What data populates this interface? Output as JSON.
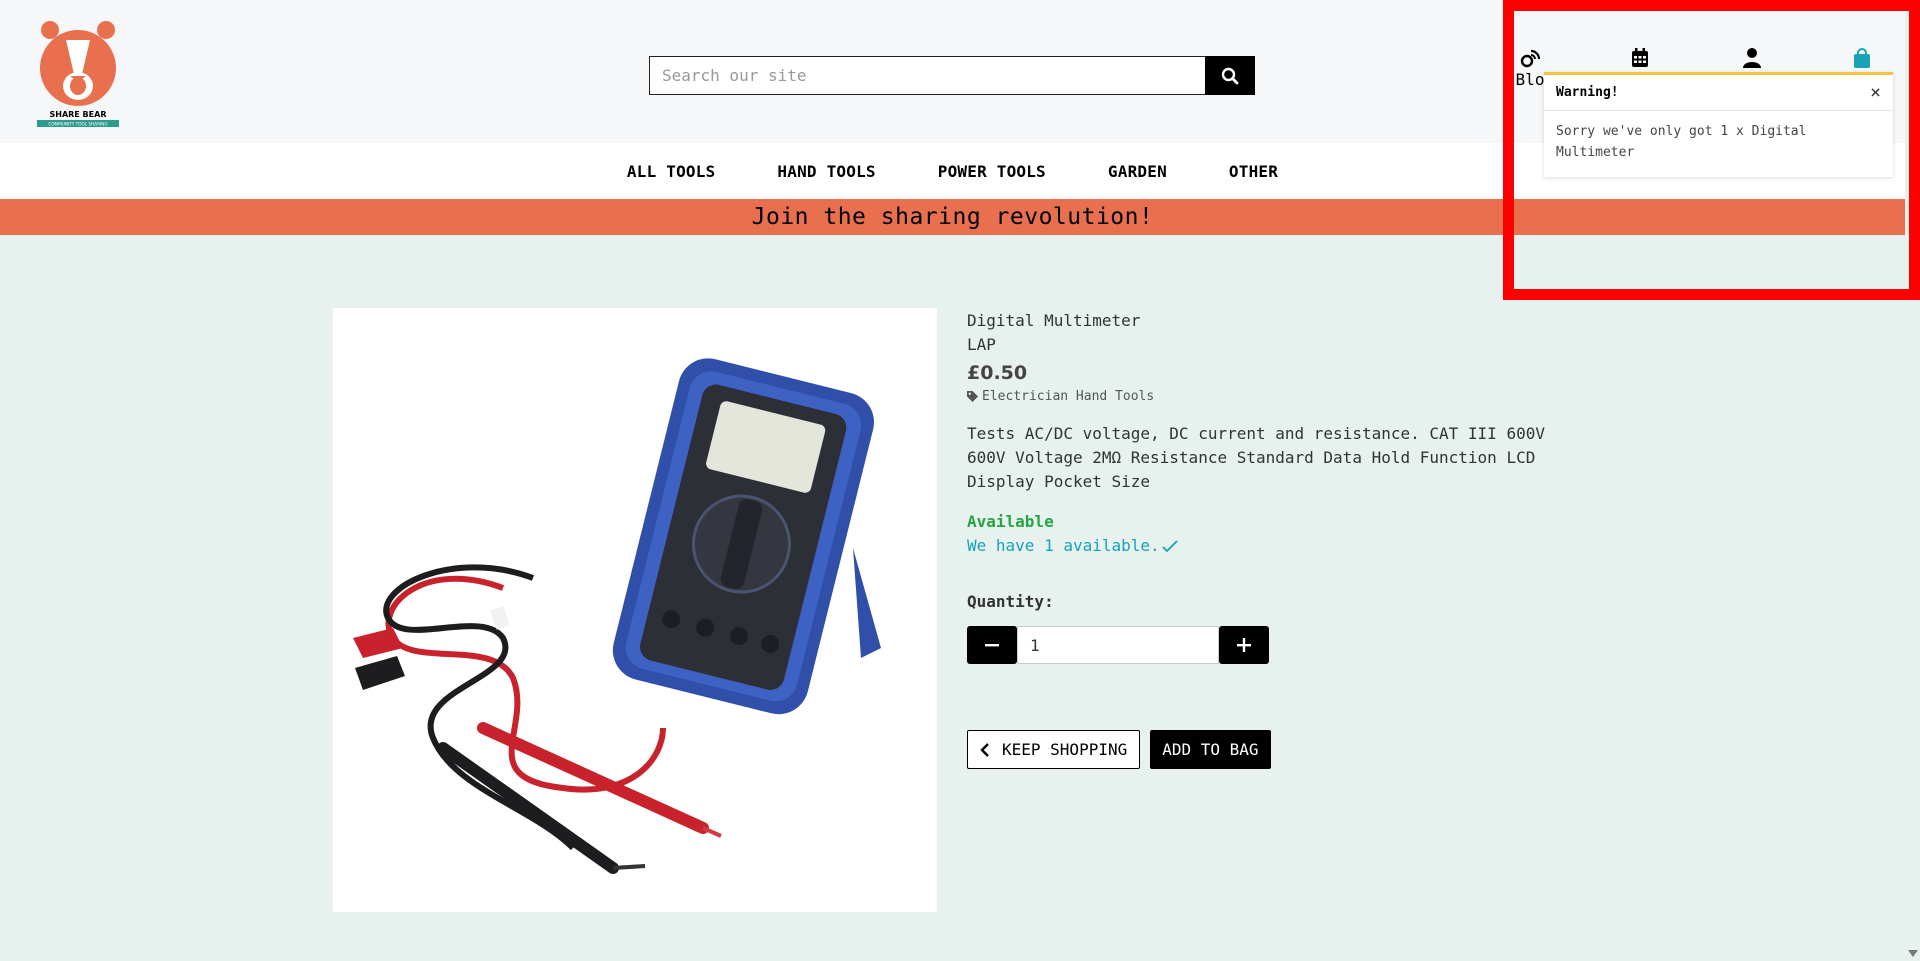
{
  "header": {
    "logo": {
      "text": "SHARE BEAR",
      "tagline": "COMMUNITY TOOL SHARING",
      "color": "#e8704f",
      "band_color": "#2a9d8f"
    },
    "search": {
      "placeholder": "Search our site",
      "value": ""
    },
    "icons": [
      {
        "icon": "blog-rss-icon",
        "label": "Blo"
      },
      {
        "icon": "calendar-icon",
        "label": ""
      },
      {
        "icon": "user-icon",
        "label": ""
      },
      {
        "icon": "shopping-bag-icon",
        "label": ""
      }
    ]
  },
  "nav": {
    "items": [
      "ALL TOOLS",
      "HAND TOOLS",
      "POWER TOOLS",
      "GARDEN",
      "OTHER"
    ]
  },
  "banner": {
    "text": "Join the sharing revolution!",
    "color": "#e8704f"
  },
  "product": {
    "name": "Digital Multimeter",
    "brand": "LAP",
    "price": "£0.50",
    "category": "Electrician Hand Tools",
    "description": "Tests AC/DC voltage, DC current and resistance. CAT III 600V 600V Voltage 2MΩ Resistance Standard Data Hold Function LCD Display Pocket Size",
    "availability": "Available",
    "available_count": "We have 1 available.",
    "quantity_label": "Quantity:",
    "quantity_value": "1",
    "keep_shopping_label": "KEEP SHOPPING",
    "add_to_bag_label": "ADD TO BAG"
  },
  "toast": {
    "title": "Warning!",
    "message": "Sorry we've only got 1 x Digital Multimeter",
    "accent": "#f6c343"
  },
  "colors": {
    "accent": "#e8704f",
    "success": "#26a544",
    "info": "#17a2b8",
    "highlight": "#ff0000"
  }
}
